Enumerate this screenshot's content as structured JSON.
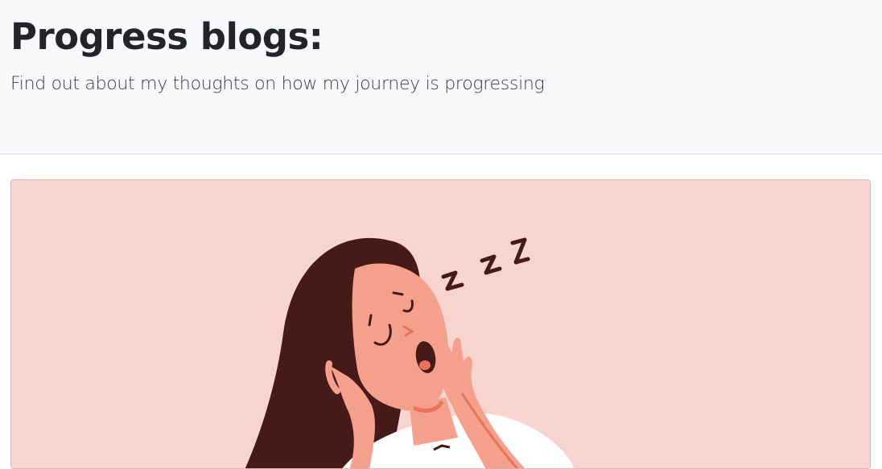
{
  "header": {
    "title": "Progress blogs:",
    "subtitle": "Find out about my thoughts on how my journey is progressing"
  },
  "card": {
    "image_subject": "woman-yawning-illustration",
    "sleep_text": "z z z"
  },
  "colors": {
    "header_bg": "#f8f9fa",
    "card_bg": "#f8d4ce",
    "hair": "#451a17",
    "skin": "#f4a08c",
    "accent": "#e8735a"
  }
}
